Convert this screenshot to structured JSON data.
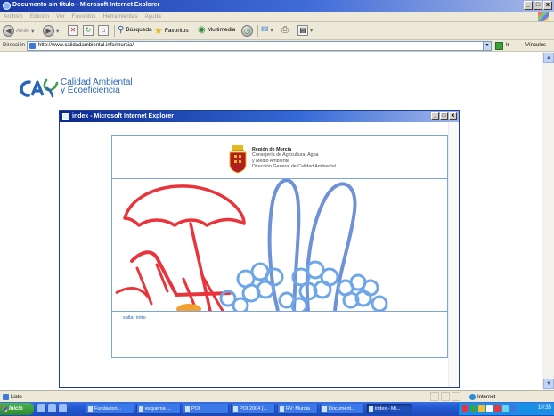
{
  "browser": {
    "window_title": "Documento sin título - Microsoft Internet Explorer",
    "menu": [
      "Archivo",
      "Edición",
      "Ver",
      "Favoritos",
      "Herramientas",
      "Ayuda"
    ],
    "toolbar": {
      "back": "Atrás",
      "search": "Búsqueda",
      "favorites": "Favoritos",
      "multimedia": "Multimedia"
    },
    "address_label": "Dirección",
    "address_url": "http://www.calidadambiental.info/murcia/",
    "go_label": "Ir",
    "links_label": "Vínculos"
  },
  "page": {
    "logo_mark": "CA",
    "logo_line1": "Calidad Ambiental",
    "logo_line2": "y Ecoeficiencia"
  },
  "popup": {
    "title": "index - Microsoft Internet Explorer",
    "region_title": "Región de Murcia",
    "region_line2": "Consejería de Agricultura, Agua",
    "region_line3": "y Medio Ambiente",
    "region_line4": "Dirección General de Calidad Ambiental",
    "intro_link": "saltar intro"
  },
  "status": {
    "text": "Listo",
    "zone": "Internet"
  },
  "taskbar": {
    "start": "Inicio",
    "tasks": [
      {
        "label": "Fundacion...",
        "active": false
      },
      {
        "label": "esquema ...",
        "active": false
      },
      {
        "label": "POI",
        "active": false
      },
      {
        "label": "POI 2004 (...",
        "active": false
      },
      {
        "label": "RV: Murcia",
        "active": false
      },
      {
        "label": "Document...",
        "active": false
      },
      {
        "label": "index - Mi...",
        "active": true
      }
    ],
    "clock": "10:35"
  },
  "colors": {
    "titlebar": "#1a3aa8",
    "logo_blue": "#2b64b6",
    "art_red": "#e8343a",
    "art_blue": "#6f92d6",
    "art_orange": "#f2a030",
    "frame_border": "#7da6d8"
  }
}
